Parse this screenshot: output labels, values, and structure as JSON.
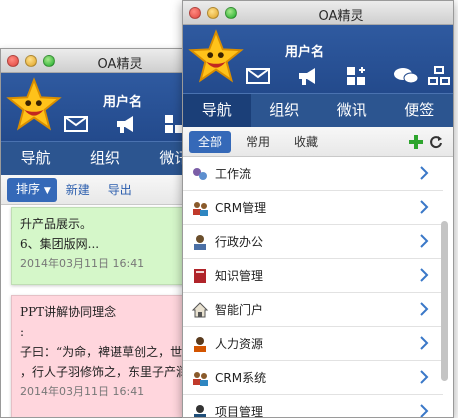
{
  "back_window": {
    "title": "OA精灵",
    "username": "用户名",
    "nav_tabs": [
      "导航",
      "组织",
      "微讯"
    ],
    "subbar": {
      "sort_label": "排序",
      "new_label": "新建",
      "export_label": "导出"
    },
    "notes": [
      {
        "color": "#d5f7c9",
        "lines": [
          "升产品展示。",
          "6、集团版网..."
        ],
        "date": "2014年03月11日 16:41"
      },
      {
        "color": "#ffd6dd",
        "lines": [
          "PPT讲解协同理念",
          ":",
          "子曰：“为命，裨谌草创之，世",
          "，行人子羽修饰之，东里子产润"
        ],
        "date": "2014年03月11日 16:41"
      }
    ]
  },
  "front_window": {
    "title": "OA精灵",
    "username": "用户名",
    "nav_tabs": [
      "导航",
      "组织",
      "微讯",
      "便签"
    ],
    "filter_tabs": [
      "全部",
      "常用",
      "收藏"
    ],
    "items": [
      {
        "label": "工作流",
        "icon": "workflow-icon"
      },
      {
        "label": "CRM管理",
        "icon": "people-icon"
      },
      {
        "label": "行政办公",
        "icon": "office-icon"
      },
      {
        "label": "知识管理",
        "icon": "book-icon"
      },
      {
        "label": "智能门户",
        "icon": "home-icon"
      },
      {
        "label": "人力资源",
        "icon": "person-icon"
      },
      {
        "label": "CRM系统",
        "icon": "people-icon"
      },
      {
        "label": "项目管理",
        "icon": "project-icon"
      }
    ]
  },
  "colors": {
    "header_blue": "#234a8c",
    "nav_active": "#1b3f78",
    "accent": "#3569b8",
    "add_green": "#2ea52e"
  }
}
